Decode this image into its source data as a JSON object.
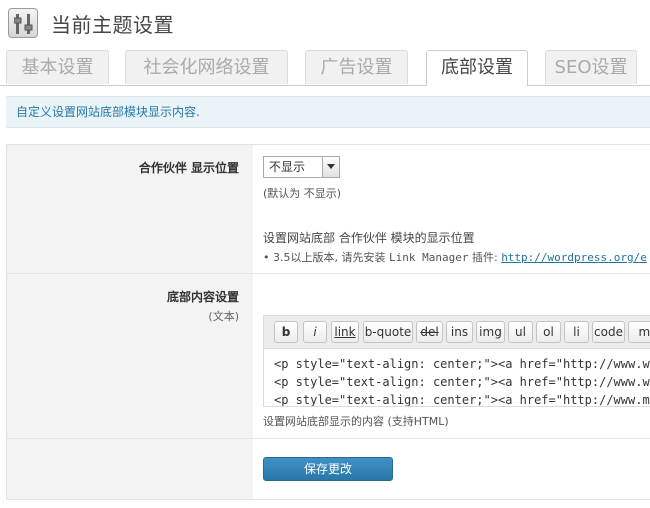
{
  "header": {
    "title": "当前主题设置"
  },
  "tabs": [
    {
      "label": "基本设置",
      "active": false
    },
    {
      "label": "社会化网络设置",
      "active": false
    },
    {
      "label": "广告设置",
      "active": false
    },
    {
      "label": "底部设置",
      "active": true
    },
    {
      "label": "SEO设置",
      "active": false
    }
  ],
  "notice": "自定义设置网站底部模块显示内容.",
  "partner": {
    "label": "合作伙伴 显示位置",
    "select_value": "不显示",
    "default_note": "(默认为 不显示)",
    "description": "设置网站底部 合作伙伴 模块的显示位置",
    "bullet_prefix": "• 3.5以上版本, 请先安装",
    "bullet_plugin": "Link Manager",
    "bullet_suffix": "插件:",
    "bullet_link": "http://wordpress.org/e"
  },
  "footer_content": {
    "label": "底部内容设置",
    "sublabel": "(文本)",
    "toolbar": [
      "b",
      "i",
      "link",
      "b-quote",
      "del",
      "ins",
      "img",
      "ul",
      "ol",
      "li",
      "code",
      "mo"
    ],
    "code_lines": [
      "<p style=\"text-align: center;\"><a href=\"http://www.wpy",
      "<p style=\"text-align: center;\"><a href=\"http://www.wpy",
      "<p style=\"text-align: center;\"><a href=\"http://www.mii"
    ],
    "help": "设置网站底部显示的内容 (支持HTML)"
  },
  "actions": {
    "save_label": "保存更改"
  },
  "colors": {
    "accent": "#2a77a8",
    "notice_text": "#2779a6",
    "notice_bg": "#e9f3f8",
    "link": "#21759b"
  }
}
